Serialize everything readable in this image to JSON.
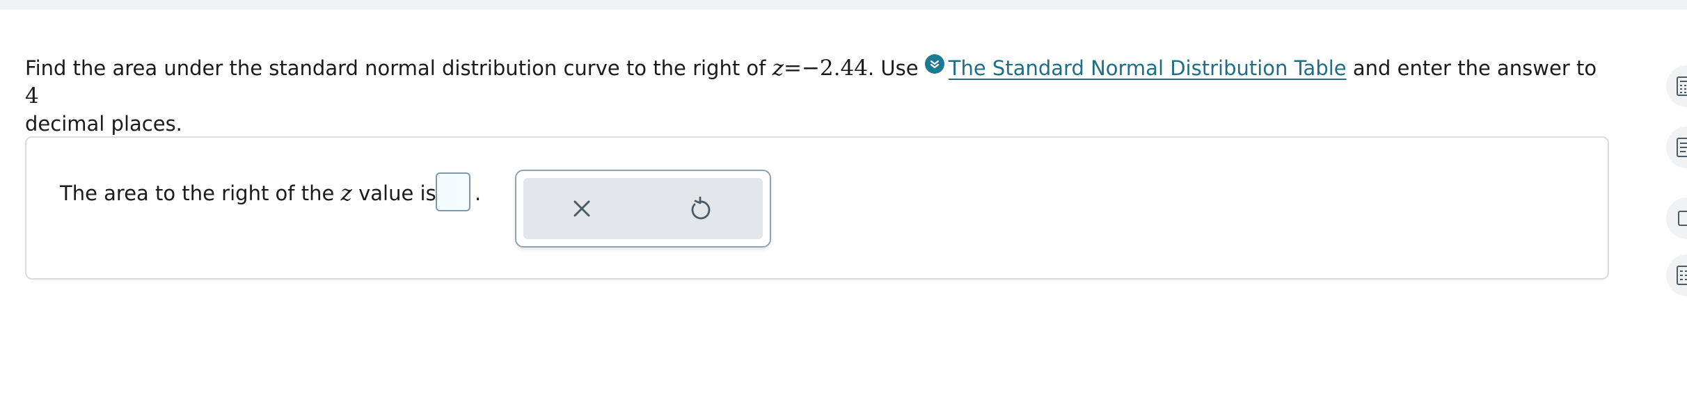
{
  "question": {
    "text_before": "Find the area under the standard normal distribution curve to the right of ",
    "z_var": "z",
    "equals": "=",
    "z_value": "−2.44",
    "text_use": ". Use ",
    "link_label": "The Standard Normal Distribution Table",
    "text_after": " and enter the answer to ",
    "decimals": "4",
    "text_end": "decimal places."
  },
  "answer": {
    "prefix": "The area to the right of the ",
    "z_var": "z",
    "suffix": " value is ",
    "input_value": "",
    "period": "."
  },
  "tools": {
    "clear_icon": "close-icon",
    "reset_icon": "undo-icon"
  },
  "side_rail": {
    "icons": [
      "calculator-icon",
      "document-icon",
      "card-icon",
      "grid-icon"
    ]
  },
  "colors": {
    "link": "#1e6f86",
    "link_icon_bg": "#1e7a93",
    "input_border": "#7a99b0",
    "input_bg": "#f4fbff",
    "tool_bg": "#e3e7ea"
  }
}
